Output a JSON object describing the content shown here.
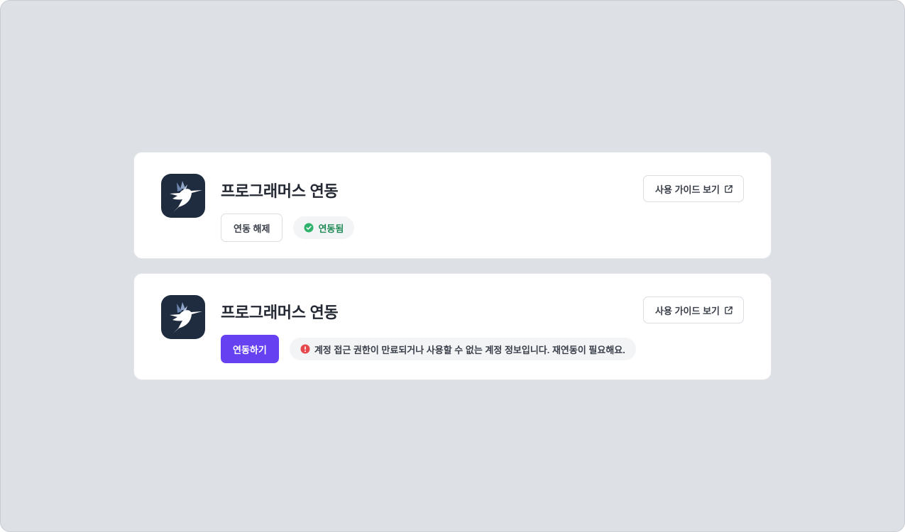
{
  "colors": {
    "background": "#dde0e5",
    "card": "#ffffff",
    "logo_bg": "#1f2b3e",
    "primary": "#6541f2",
    "success": "#1f8a55",
    "success_icon": "#2fb26b",
    "error_icon": "#e5484d"
  },
  "cards": [
    {
      "logo_icon": "hummingbird-logo-icon",
      "title": "프로그래머스 연동",
      "guide_button": {
        "label": "사용 가이드 보기",
        "icon": "external-link-icon"
      },
      "action_button": {
        "label": "연동 해제",
        "style": "outline"
      },
      "status": {
        "icon": "check-circle-icon",
        "text": "연동됨",
        "state": "connected"
      }
    },
    {
      "logo_icon": "hummingbird-logo-icon",
      "title": "프로그래머스 연동",
      "guide_button": {
        "label": "사용 가이드 보기",
        "icon": "external-link-icon"
      },
      "action_button": {
        "label": "연동하기",
        "style": "primary"
      },
      "status": {
        "icon": "alert-circle-icon",
        "text": "계정 접근 권한이 만료되거나 사용할 수 없는 계정 정보입니다. 재연동이 필요해요.",
        "state": "error"
      }
    }
  ]
}
